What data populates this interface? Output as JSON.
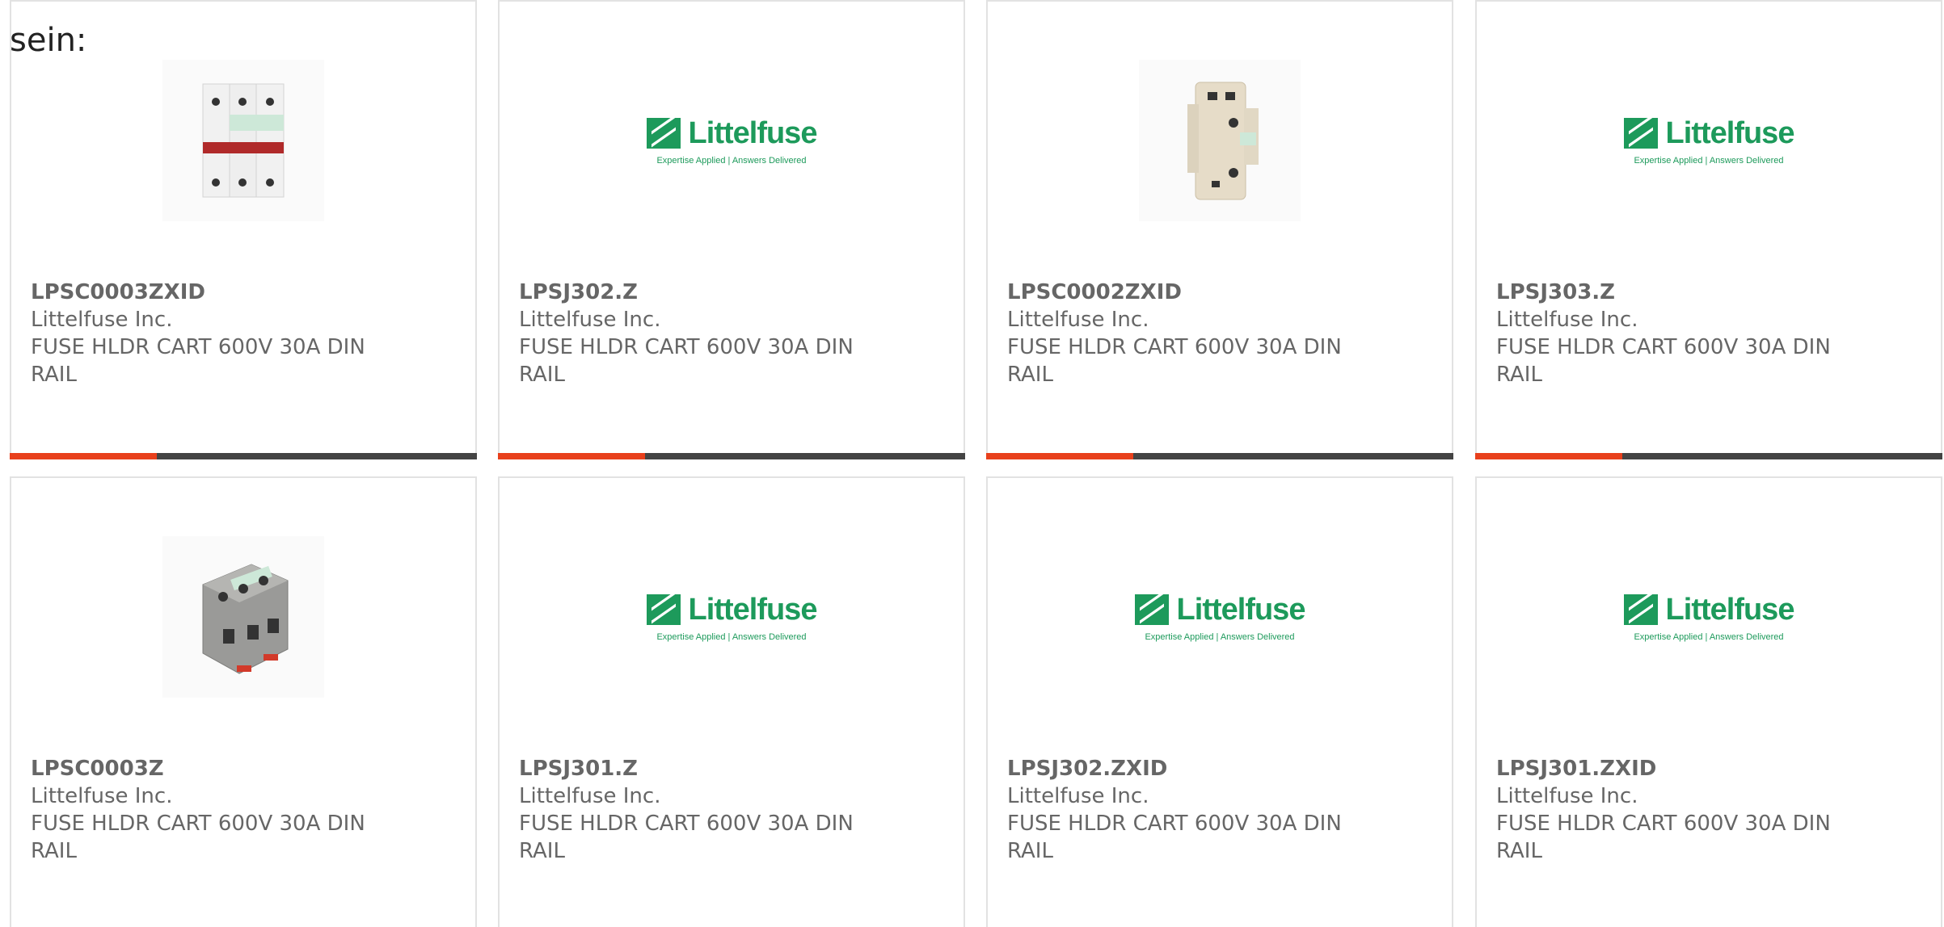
{
  "intro_text": "sein:",
  "colors": {
    "accent": "#e8401c",
    "bar_track": "#444444",
    "brand_green": "#1d9a5b"
  },
  "logo": {
    "word": "Littelfuse",
    "tagline": "Expertise Applied | Answers Delivered"
  },
  "products": [
    {
      "part": "LPSC0003ZXID",
      "manufacturer": "Littelfuse Inc.",
      "desc1": "FUSE HLDR CART 600V 30A DIN",
      "desc2": "RAIL",
      "image": "fuse-holder-3pole-photo",
      "progress": 0.315
    },
    {
      "part": "LPSJ302.Z",
      "manufacturer": "Littelfuse Inc.",
      "desc1": "FUSE HLDR CART 600V 30A DIN",
      "desc2": "RAIL",
      "image": "littelfuse-logo",
      "progress": 0.315
    },
    {
      "part": "LPSC0002ZXID",
      "manufacturer": "Littelfuse Inc.",
      "desc1": "FUSE HLDR CART 600V 30A DIN",
      "desc2": "RAIL",
      "image": "fuse-holder-2pole-photo",
      "progress": 0.315
    },
    {
      "part": "LPSJ303.Z",
      "manufacturer": "Littelfuse Inc.",
      "desc1": "FUSE HLDR CART 600V 30A DIN",
      "desc2": "RAIL",
      "image": "littelfuse-logo",
      "progress": 0.315
    },
    {
      "part": "LPSC0003Z",
      "manufacturer": "Littelfuse Inc.",
      "desc1": "FUSE HLDR CART 600V 30A DIN",
      "desc2": "RAIL",
      "image": "fuse-holder-3pole-gray-photo"
    },
    {
      "part": "LPSJ301.Z",
      "manufacturer": "Littelfuse Inc.",
      "desc1": "FUSE HLDR CART 600V 30A DIN",
      "desc2": "RAIL",
      "image": "littelfuse-logo"
    },
    {
      "part": "LPSJ302.ZXID",
      "manufacturer": "Littelfuse Inc.",
      "desc1": "FUSE HLDR CART 600V 30A DIN",
      "desc2": "RAIL",
      "image": "littelfuse-logo"
    },
    {
      "part": "LPSJ301.ZXID",
      "manufacturer": "Littelfuse Inc.",
      "desc1": "FUSE HLDR CART 600V 30A DIN",
      "desc2": "RAIL",
      "image": "littelfuse-logo"
    }
  ]
}
